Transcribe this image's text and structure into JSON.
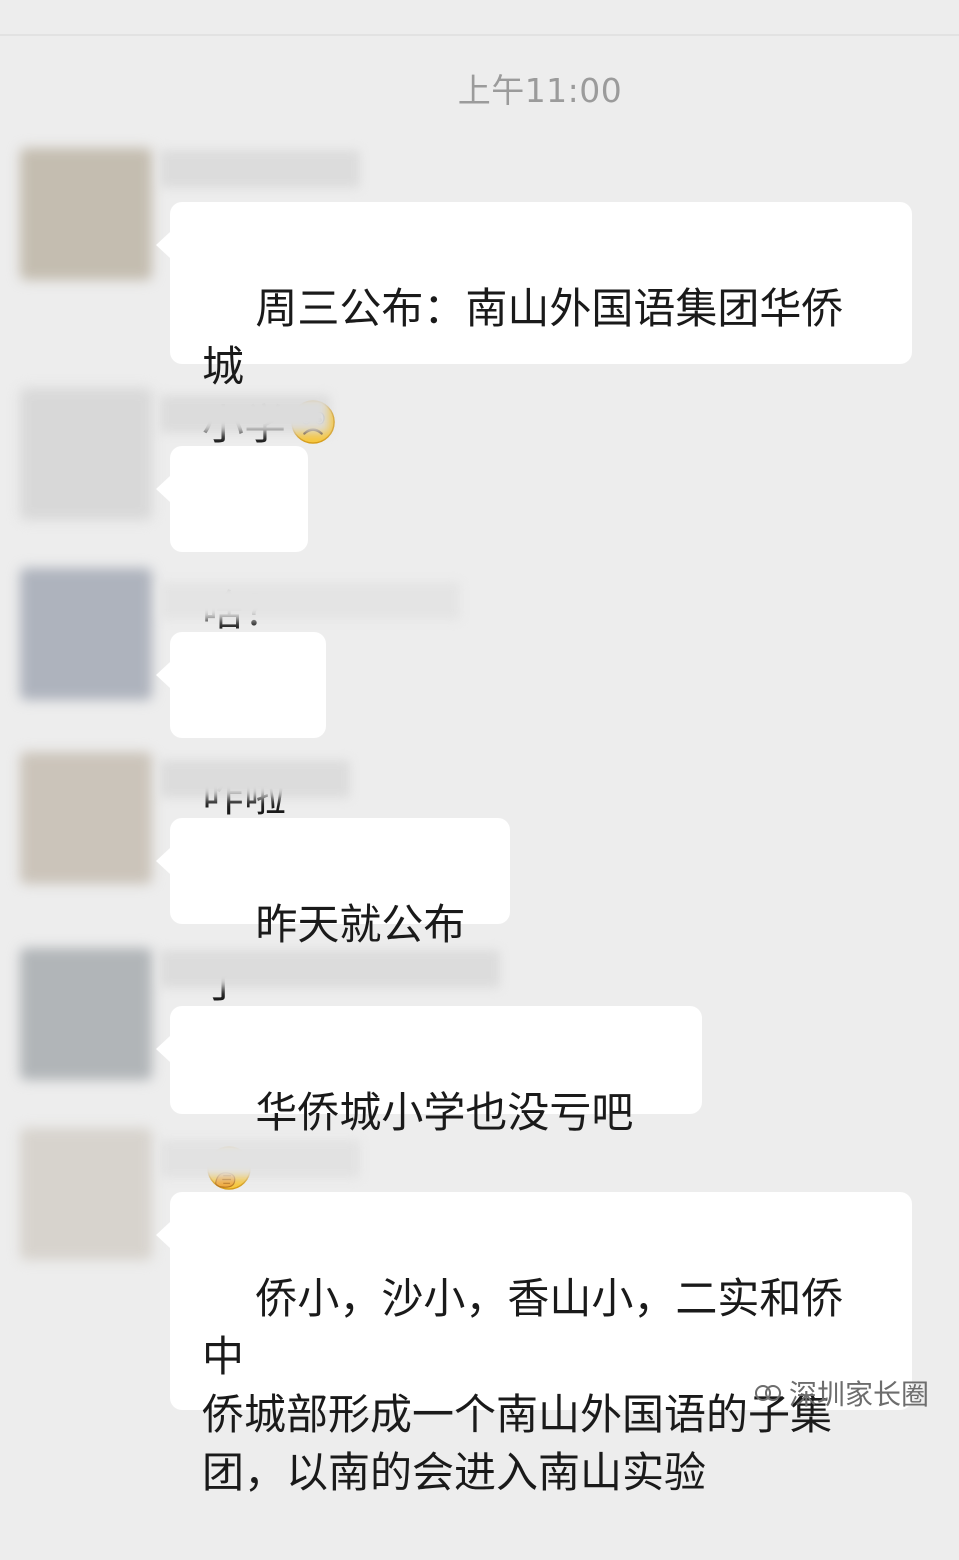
{
  "timestamp": "上午11:00",
  "messages": [
    {
      "text": "周三公布：南山外国语集团华侨城\n小学",
      "emoji": "frowning-face-icon"
    },
    {
      "text": "啥？"
    },
    {
      "text": "咋啦"
    },
    {
      "text": "昨天就公布了"
    },
    {
      "text": "华侨城小学也没亏吧",
      "emoji": "hand-over-mouth-icon"
    },
    {
      "text": "侨小，沙小，香山小，二实和侨中\n侨城部形成一个南山外国语的子集\n团，以南的会进入南山实验"
    }
  ],
  "watermark": {
    "icon": "wechat-channel-icon",
    "text": "深圳家长圈"
  }
}
